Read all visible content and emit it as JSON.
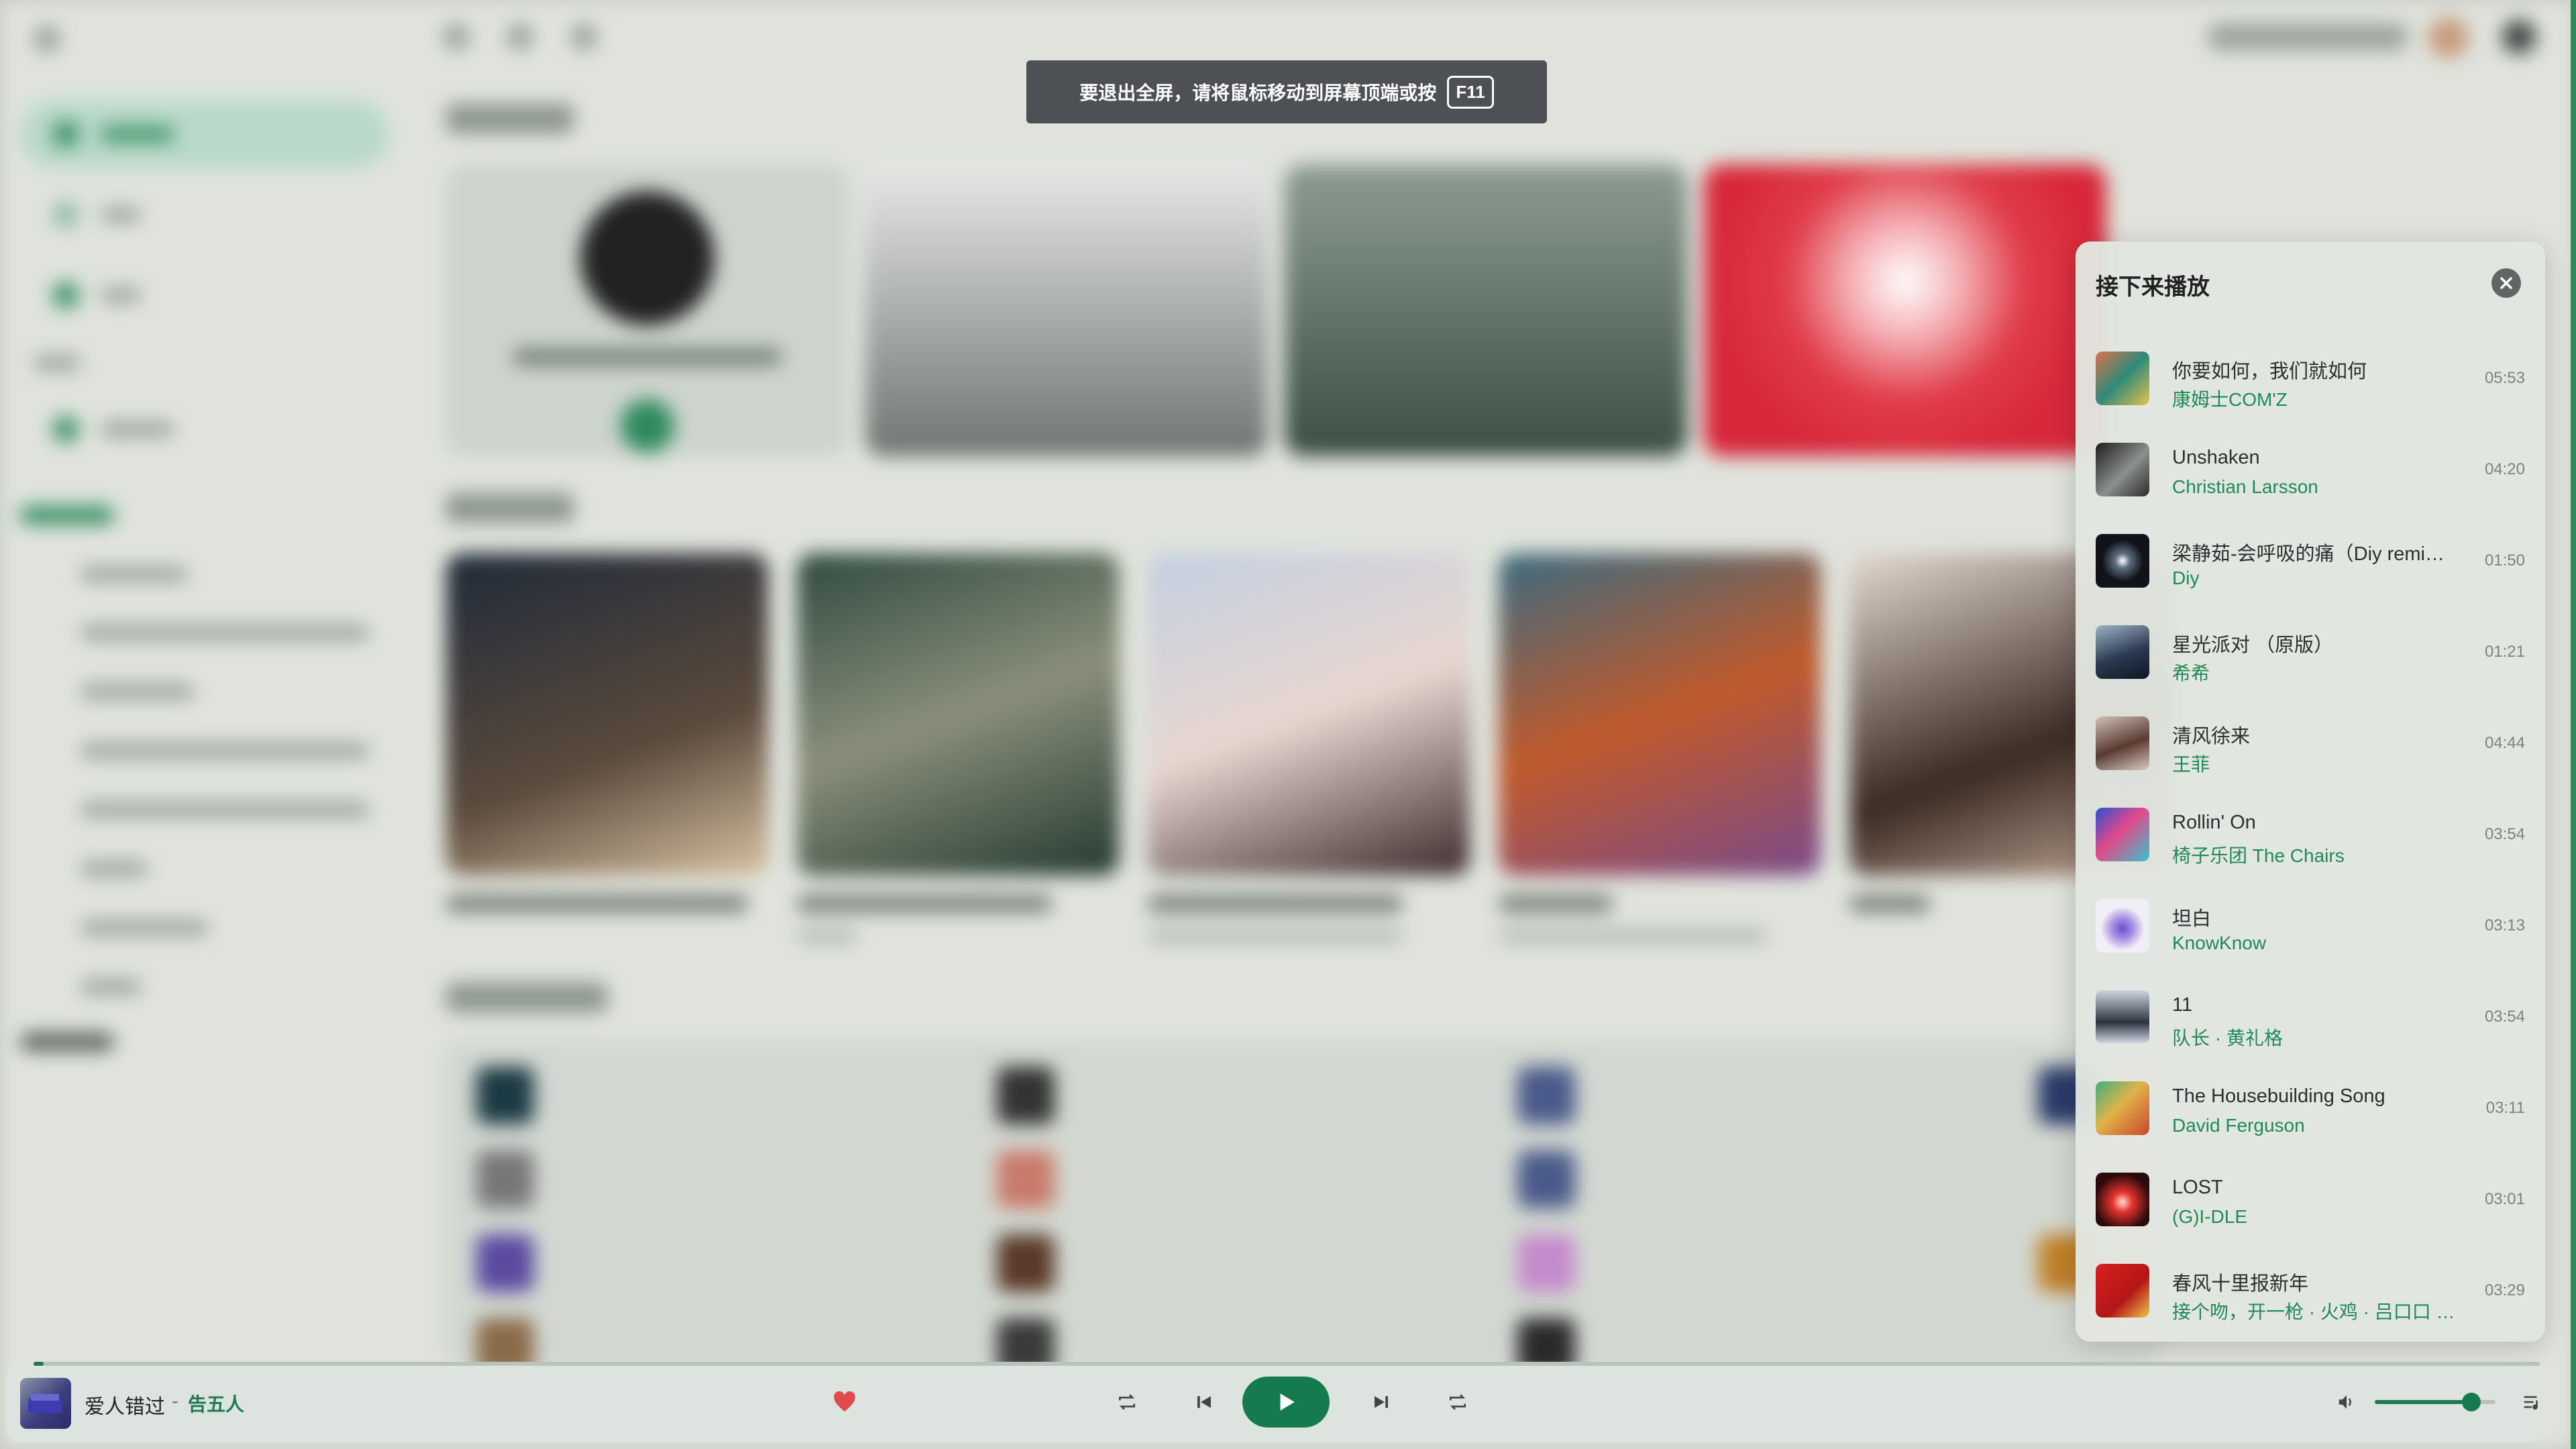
{
  "fullscreen_toast": {
    "text": "要退出全屏，请将鼠标移动到屏幕顶端或按",
    "key": "F11"
  },
  "queue": {
    "title": "接下来播放",
    "close_icon": "close-icon",
    "items": [
      {
        "title": "你要如何，我们就如何",
        "artist": "康姆士COM'Z",
        "duration": "05:53"
      },
      {
        "title": "Unshaken",
        "artist": "Christian Larsson",
        "duration": "04:20"
      },
      {
        "title": "梁静茹-会呼吸的痛（Diy remix）",
        "artist": "Diy",
        "duration": "01:50"
      },
      {
        "title": "星光派对 （原版）",
        "artist": "希希",
        "duration": "01:21"
      },
      {
        "title": "清风徐来",
        "artist": "王菲",
        "duration": "04:44"
      },
      {
        "title": "Rollin' On",
        "artist": "椅子乐团 The Chairs",
        "duration": "03:54"
      },
      {
        "title": "坦白",
        "artist": "KnowKnow",
        "duration": "03:13"
      },
      {
        "title": "11",
        "artist": "队长 · 黄礼格",
        "duration": "03:54"
      },
      {
        "title": "The Housebuilding Song",
        "artist": "David Ferguson",
        "duration": "03:11"
      },
      {
        "title": "LOST",
        "artist": "(G)I-DLE",
        "duration": "03:01"
      },
      {
        "title": "春风十里报新年",
        "artist": "接个吻，开一枪 · 火鸡 · 吕口口 · ...",
        "duration": "03:29"
      }
    ]
  },
  "player": {
    "track_title": "爱人错过",
    "separator": "-",
    "artist": "告五人",
    "liked": true,
    "progress_fraction": 0.004,
    "volume_fraction": 0.8,
    "icons": [
      "heart-icon",
      "repeat-icon",
      "previous-icon",
      "play-icon",
      "next-icon",
      "shuffle-icon",
      "volume-icon",
      "playlist-icon"
    ]
  },
  "colors": {
    "accent": "#167a4f",
    "artist_green": "#1f8a57"
  }
}
